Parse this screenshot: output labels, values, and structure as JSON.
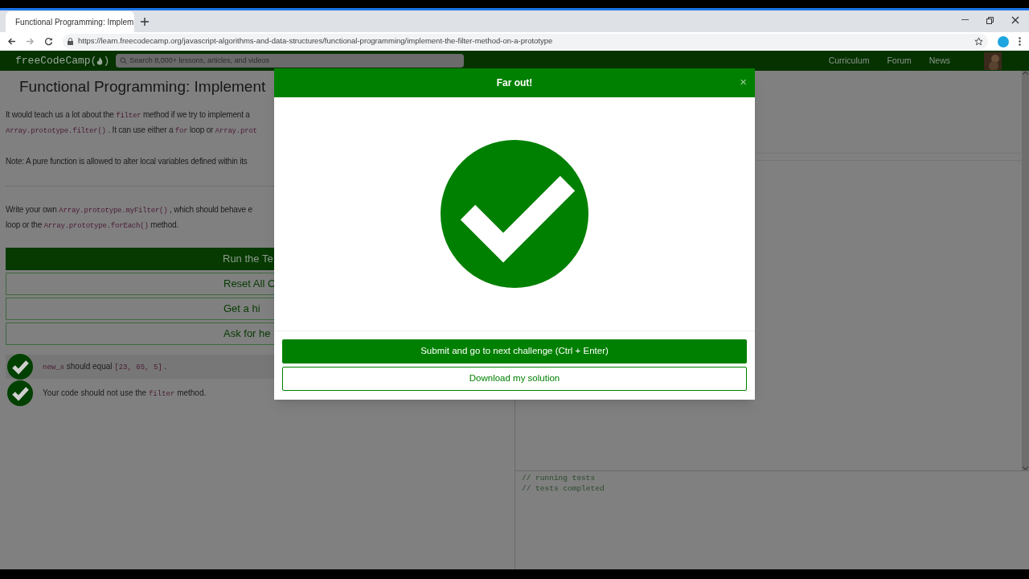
{
  "browser": {
    "tab_title": "Functional Programming: Implem",
    "url": "https://learn.freecodecamp.org/javascript-algorithms-and-data-structures/functional-programming/implement-the-filter-method-on-a-prototype"
  },
  "nav": {
    "logo_prefix": "freeCodeCamp(",
    "logo_suffix": ")",
    "search_placeholder": "Search 8,000+ lessons, articles, and videos",
    "links": [
      "Curriculum",
      "Forum",
      "News"
    ]
  },
  "lesson": {
    "title": "Functional Programming: Implement",
    "paragraphs": [
      [
        [
          {
            "text": "It would teach us a lot about the ",
            "code": false
          },
          {
            "text": "filter",
            "code": true
          },
          {
            "text": " method if we try to implement a",
            "code": false
          }
        ],
        [
          {
            "text": "Array.prototype.filter()",
            "code": true
          },
          {
            "text": " . It can use either a ",
            "code": false
          },
          {
            "text": "for",
            "code": true
          },
          {
            "text": " loop or ",
            "code": false
          },
          {
            "text": "Array.prot",
            "code": true
          }
        ]
      ],
      [
        [
          {
            "text": "Note: A pure function is allowed to alter local variables defined within its",
            "code": false
          }
        ]
      ],
      [
        [
          {
            "text": "Write your own ",
            "code": false
          },
          {
            "text": "Array.prototype.myFilter()",
            "code": true
          },
          {
            "text": " , which should behave e",
            "code": false
          }
        ],
        [
          {
            "text": "loop or the ",
            "code": false
          },
          {
            "text": "Array.prototype.forEach()",
            "code": true
          },
          {
            "text": " method.",
            "code": false
          }
        ]
      ]
    ],
    "buttons": [
      {
        "label": "Run the Te",
        "kind": "primary"
      },
      {
        "label": "Reset All C",
        "kind": "outline"
      },
      {
        "label": "Get a hi",
        "kind": "outline"
      },
      {
        "label": "Ask for he",
        "kind": "outline"
      }
    ],
    "tests": [
      {
        "passed": true,
        "highlighted": true,
        "segments": [
          {
            "text": "new_s",
            "code": true
          },
          {
            "text": " should equal ",
            "code": false
          },
          {
            "text": "[23, 65, 5]",
            "code": true
          },
          {
            "text": " .",
            "code": false
          }
        ]
      },
      {
        "passed": true,
        "highlighted": false,
        "segments": [
          {
            "text": "Your code should not use the ",
            "code": false
          },
          {
            "text": "filter",
            "code": true
          },
          {
            "text": " method.",
            "code": false
          }
        ]
      }
    ]
  },
  "console": [
    "// running tests",
    "// tests completed"
  ],
  "modal": {
    "title": "Far out!",
    "close": "×",
    "buttons": [
      {
        "label": "Submit and go to next challenge (Ctrl + Enter)",
        "kind": "primary"
      },
      {
        "label": "Download my solution",
        "kind": "outline"
      }
    ]
  }
}
